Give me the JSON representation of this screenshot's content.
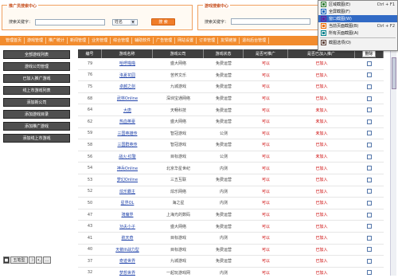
{
  "search_left": {
    "title": "推广员搜索中心",
    "label": "搜索关键字：",
    "select_value": "姓名",
    "button": "搜 索"
  },
  "search_right": {
    "title": "游戏搜索中心",
    "label": "搜索关键字："
  },
  "nav": [
    "管理首页",
    "游戏管理",
    "推广统计",
    "新闻管理",
    "业务管理",
    "综合管理",
    "辅助软件",
    "广告管理",
    "网站设置",
    "订单管理",
    "友情链接",
    "退出后台管理"
  ],
  "sidebar": [
    "全部游戏列表",
    "游戏公司管理",
    "已加入推广游戏",
    "线上市游戏列表",
    "添加新公司",
    "添加游戏目录",
    "添加推广游戏",
    "添加线上市游戏"
  ],
  "sidetools": {
    "lang": "五笔型",
    "moon": "☽",
    "comma": "•,",
    "dots": "..."
  },
  "table": {
    "headers": [
      "编号",
      "游戏名称",
      "游戏公司",
      "游戏状态",
      "是否可推广",
      "是否已加入推广",
      "删除"
    ],
    "rows": [
      {
        "id": "79",
        "name": "哈啰啪啪",
        "company": "盛大网络",
        "status": "免费运营",
        "hot": "可以",
        "push": "已加入"
      },
      {
        "id": "76",
        "name": "洛夏花园",
        "company": "苦荞文乐",
        "status": "免费运营",
        "hot": "可以",
        "push": "已加入"
      },
      {
        "id": "75",
        "name": "卓越之剑",
        "company": "九城游戏",
        "status": "免费运营",
        "hot": "可以",
        "push": "已加入"
      },
      {
        "id": "68",
        "name": "武林Online",
        "company": "深圳宝通网络",
        "status": "免费运营",
        "hot": "可以",
        "push": "已加入"
      },
      {
        "id": "64",
        "name": "大唐",
        "company": "天畅科技",
        "status": "免费运营",
        "hot": "可以",
        "push": "未加入"
      },
      {
        "id": "62",
        "name": "热血英豪",
        "company": "盛大网络",
        "status": "免费运营",
        "hot": "可以",
        "push": "未加入"
      },
      {
        "id": "59",
        "name": "三国英雄传",
        "company": "智冠游戏",
        "status": "公测",
        "hot": "可以",
        "push": "未加入"
      },
      {
        "id": "58",
        "name": "三国群英传",
        "company": "智冠游戏",
        "status": "免费运营",
        "hot": "可以",
        "push": "已加入"
      },
      {
        "id": "56",
        "name": "战火·红警",
        "company": "目标游戏",
        "status": "公测",
        "hot": "可以",
        "push": "未加入"
      },
      {
        "id": "54",
        "name": "神兵Online",
        "company": "北京华星世纪",
        "status": "内测",
        "hot": "可以",
        "push": "已加入"
      },
      {
        "id": "53",
        "name": "梦幻Online",
        "company": "三五互联",
        "status": "免费运营",
        "hot": "可以",
        "push": "已加入"
      },
      {
        "id": "52",
        "name": "炫乐霸主",
        "company": "炫乐网络",
        "status": "内测",
        "hot": "可以",
        "push": "已加入"
      },
      {
        "id": "50",
        "name": "星界OL",
        "company": "海之星",
        "status": "内测",
        "hot": "可以",
        "push": "已加入"
      },
      {
        "id": "47",
        "name": "骑魔界",
        "company": "上海光的数码",
        "status": "免费运营",
        "hot": "可以",
        "push": "已加入"
      },
      {
        "id": "43",
        "name": "功夫小子",
        "company": "盛大网络",
        "status": "免费运营",
        "hot": "可以",
        "push": "已加入"
      },
      {
        "id": "41",
        "name": "航天奇",
        "company": "目标游戏",
        "status": "内测",
        "hot": "可以",
        "push": "已加入"
      },
      {
        "id": "40",
        "name": "天鹅III战力型",
        "company": "目标游戏",
        "status": "免费运营",
        "hot": "可以",
        "push": "已加入"
      },
      {
        "id": "37",
        "name": "奇迹世界",
        "company": "九城游戏",
        "status": "免费运营",
        "hot": "可以",
        "push": "已加入"
      },
      {
        "id": "32",
        "name": "梦想世界",
        "company": "一起玩游戏网",
        "status": "内测",
        "hot": "可以",
        "push": "已加入"
      }
    ]
  },
  "context_menu": {
    "items": [
      {
        "label": "区域截图(E)",
        "shortcut": "Ctrl + F1",
        "icon": "region-capture-icon",
        "highlight": false
      },
      {
        "label": "全屏截图(F)",
        "shortcut": "",
        "icon": "fullscreen-capture-icon",
        "highlight": false
      },
      {
        "label": "窗口截图(W)",
        "shortcut": "",
        "icon": "window-capture-icon",
        "highlight": true
      },
      {
        "label": "当前页面截图(B)",
        "shortcut": "Ctrl + F2",
        "icon": "page-capture-icon",
        "highlight": false
      },
      {
        "label": "所有页面截图(A)",
        "shortcut": "",
        "icon": "all-pages-capture-icon",
        "highlight": false
      },
      {
        "label": "截图选项(O)",
        "shortcut": "",
        "icon": "options-icon",
        "highlight": false
      }
    ]
  }
}
